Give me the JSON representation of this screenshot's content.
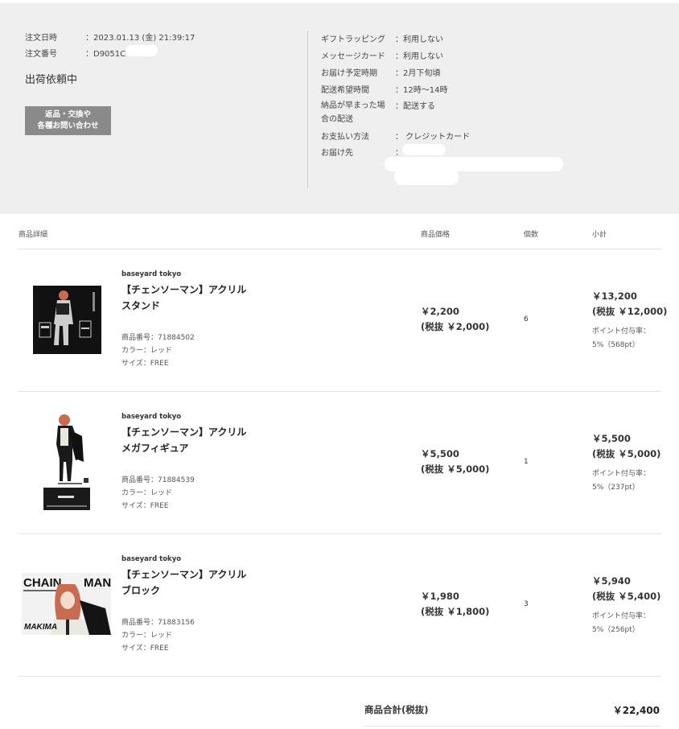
{
  "order": {
    "date_label": "注文日時",
    "date_value": "：2023.01.13 (金) 21:39:17",
    "number_label": "注文番号",
    "number_value": "：D9051C",
    "status": "出荷依頼中",
    "inquiry_button": "返品・交換や\n各種お問い合わせ"
  },
  "details": [
    {
      "label": "ギフトラッピング",
      "value": "：利用しない"
    },
    {
      "label": "メッセージカード",
      "value": "：利用しない"
    },
    {
      "label": "お届け予定時期",
      "value": "：2月下旬頃"
    },
    {
      "label": "配送希望時間",
      "value": "：12時〜14時"
    },
    {
      "label": "納品が早まった場\n合の配送",
      "value": "：配送する"
    },
    {
      "label": "お支払い方法",
      "value": "： クレジットカード"
    },
    {
      "label": "お届け先",
      "value": "："
    }
  ],
  "table": {
    "col_detail": "商品詳細",
    "col_price": "商品価格",
    "col_qty": "個数",
    "col_subtotal": "小計"
  },
  "items": [
    {
      "brand": "baseyard tokyo",
      "name": "【チェンソーマン】アクリルスタンド",
      "number": "商品番号：71884502",
      "color": "カラー：レッド",
      "size": "サイズ：FREE",
      "price": "￥2,200",
      "price_ex": "(税抜 ￥2,000)",
      "qty": "6",
      "subtotal": "￥13,200",
      "subtotal_ex": "(税抜 ￥12,000)",
      "points_label": "ポイント付与率：",
      "points_value": "5%（568pt）"
    },
    {
      "brand": "baseyard tokyo",
      "name": "【チェンソーマン】アクリルメガフィギュア",
      "number": "商品番号：71884539",
      "color": "カラー：レッド",
      "size": "サイズ：FREE",
      "price": "￥5,500",
      "price_ex": "(税抜 ￥5,000)",
      "qty": "1",
      "subtotal": "￥5,500",
      "subtotal_ex": "(税抜 ￥5,000)",
      "points_label": "ポイント付与率：",
      "points_value": "5%（237pt）"
    },
    {
      "brand": "baseyard tokyo",
      "name": "【チェンソーマン】アクリルブロック",
      "number": "商品番号：71883156",
      "color": "カラー：レッド",
      "size": "サイズ：FREE",
      "price": "￥1,980",
      "price_ex": "(税抜 ￥1,800)",
      "qty": "3",
      "subtotal": "￥5,940",
      "subtotal_ex": "(税抜 ￥5,400)",
      "points_label": "ポイント付与率：",
      "points_value": "5%（256pt）"
    }
  ],
  "thumb3": {
    "logo": "CHAIN",
    "logo2": "MAN",
    "character": "MAKIMA"
  },
  "total": {
    "label": "商品合計(税抜)",
    "value": "￥22,400"
  },
  "colors": {
    "panel_bg": "#efefef",
    "button_bg": "#8a8a8a",
    "hair": "#d46a4a"
  }
}
